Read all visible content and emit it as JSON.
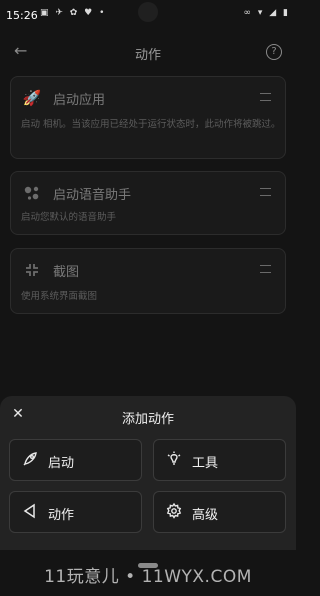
{
  "status_bar": {
    "time": "15:26",
    "left_icons": "▣ ✈ ✿ ♥ •",
    "right_icons": "∞ ▾ ◢ ▮"
  },
  "app_bar": {
    "title": "动作",
    "back_icon": "←",
    "help_icon": "?"
  },
  "actions": [
    {
      "icon": "rocket-icon",
      "icon_glyph": "🚀",
      "title": "启动应用",
      "description": "启动 相机。当该应用已经处于运行状态时，此动作将被跳过。"
    },
    {
      "icon": "assistant-icon",
      "icon_glyph": "●",
      "title": "启动语音助手",
      "description": "启动您默认的语音助手"
    },
    {
      "icon": "screenshot-icon",
      "icon_glyph": "⛶",
      "title": "截图",
      "description": "使用系统界面截图"
    }
  ],
  "sheet": {
    "title": "添加动作",
    "close_icon": "✕",
    "options": [
      {
        "label": "启动",
        "icon_glyph": "🚀"
      },
      {
        "label": "工具",
        "icon_glyph": "💡"
      },
      {
        "label": "动作",
        "icon_glyph": "◁"
      },
      {
        "label": "高级",
        "icon_glyph": "⚙"
      }
    ]
  },
  "watermark": "11玩意儿 • 11WYX.COM"
}
